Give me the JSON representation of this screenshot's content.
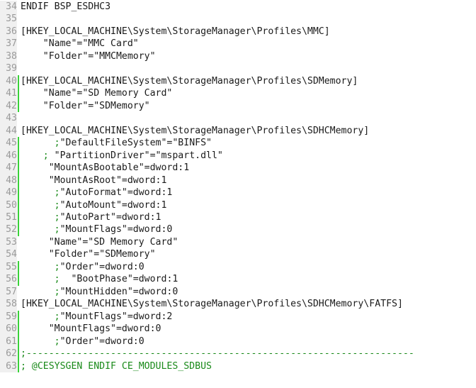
{
  "editor": {
    "type": "source-code-editor",
    "language": "registry-reg",
    "colors": {
      "background": "#ffffff",
      "gutter_background": "#f0f0f0",
      "line_number": "#9a9a9a",
      "text": "#1a1a1a",
      "comment": "#1a8a1a",
      "modified_marker": "#3ad13a"
    },
    "first_line_number": 34,
    "last_line_number": 63,
    "lines": [
      {
        "number": "34",
        "modified": false,
        "text": "ENDIF BSP_ESDHC3",
        "comment": false
      },
      {
        "number": "35",
        "modified": false,
        "text": "",
        "comment": false
      },
      {
        "number": "36",
        "modified": false,
        "text": "[HKEY_LOCAL_MACHINE\\System\\StorageManager\\Profiles\\MMC]",
        "comment": false
      },
      {
        "number": "37",
        "modified": false,
        "text": "    \"Name\"=\"MMC Card\"",
        "comment": false
      },
      {
        "number": "38",
        "modified": false,
        "text": "    \"Folder\"=\"MMCMemory\"",
        "comment": false
      },
      {
        "number": "39",
        "modified": false,
        "text": "",
        "comment": false
      },
      {
        "number": "40",
        "modified": true,
        "text": "[HKEY_LOCAL_MACHINE\\System\\StorageManager\\Profiles\\SDMemory]",
        "comment": false
      },
      {
        "number": "41",
        "modified": true,
        "text": "    \"Name\"=\"SD Memory Card\"",
        "comment": false
      },
      {
        "number": "42",
        "modified": true,
        "text": "    \"Folder\"=\"SDMemory\"",
        "comment": false
      },
      {
        "number": "43",
        "modified": false,
        "text": "",
        "comment": false
      },
      {
        "number": "44",
        "modified": false,
        "text": "[HKEY_LOCAL_MACHINE\\System\\StorageManager\\Profiles\\SDHCMemory]",
        "comment": false
      },
      {
        "number": "45",
        "modified": true,
        "prefix": "      ;",
        "text": "\"DefaultFileSystem\"=\"BINFS\"",
        "comment": false
      },
      {
        "number": "46",
        "modified": true,
        "prefix": "    ; ",
        "text": "\"PartitionDriver\"=\"mspart.dll\"",
        "comment": false
      },
      {
        "number": "47",
        "modified": true,
        "text": "     \"MountAsBootable\"=dword:1",
        "comment": false
      },
      {
        "number": "48",
        "modified": true,
        "text": "     \"MountAsRoot\"=dword:1",
        "comment": false
      },
      {
        "number": "49",
        "modified": true,
        "prefix": "      ;",
        "text": "\"AutoFormat\"=dword:1",
        "comment": false
      },
      {
        "number": "50",
        "modified": true,
        "prefix": "      ;",
        "text": "\"AutoMount\"=dword:1",
        "comment": false
      },
      {
        "number": "51",
        "modified": true,
        "prefix": "      ;",
        "text": "\"AutoPart\"=dword:1",
        "comment": false
      },
      {
        "number": "52",
        "modified": true,
        "prefix": "      ;",
        "text": "\"MountFlags\"=dword:0",
        "comment": false
      },
      {
        "number": "53",
        "modified": false,
        "text": "     \"Name\"=\"SD Memory Card\"",
        "comment": false
      },
      {
        "number": "54",
        "modified": false,
        "text": "     \"Folder\"=\"SDMemory\"",
        "comment": false
      },
      {
        "number": "55",
        "modified": true,
        "prefix": "      ;",
        "text": "\"Order\"=dword:0",
        "comment": false
      },
      {
        "number": "56",
        "modified": true,
        "prefix": "      ; ",
        "text": " \"BootPhase\"=dword:1",
        "comment": false
      },
      {
        "number": "57",
        "modified": false,
        "prefix": "      ;",
        "text": "\"MountHidden\"=dword:0",
        "comment": false
      },
      {
        "number": "58",
        "modified": false,
        "text": "[HKEY_LOCAL_MACHINE\\System\\StorageManager\\Profiles\\SDHCMemory\\FATFS]",
        "comment": false
      },
      {
        "number": "59",
        "modified": true,
        "prefix": "      ;",
        "text": "\"MountFlags\"=dword:2",
        "comment": false
      },
      {
        "number": "60",
        "modified": true,
        "text": "     \"MountFlags\"=dword:0",
        "comment": false
      },
      {
        "number": "61",
        "modified": true,
        "prefix": "      ;",
        "text": "\"Order\"=dword:0",
        "comment": false
      },
      {
        "number": "62",
        "modified": true,
        "text": ";---------------------------------------------------------------------",
        "comment": true
      },
      {
        "number": "63",
        "modified": true,
        "text": "; @CESYSGEN ENDIF CE_MODULES_SDBUS",
        "comment": true
      }
    ]
  }
}
